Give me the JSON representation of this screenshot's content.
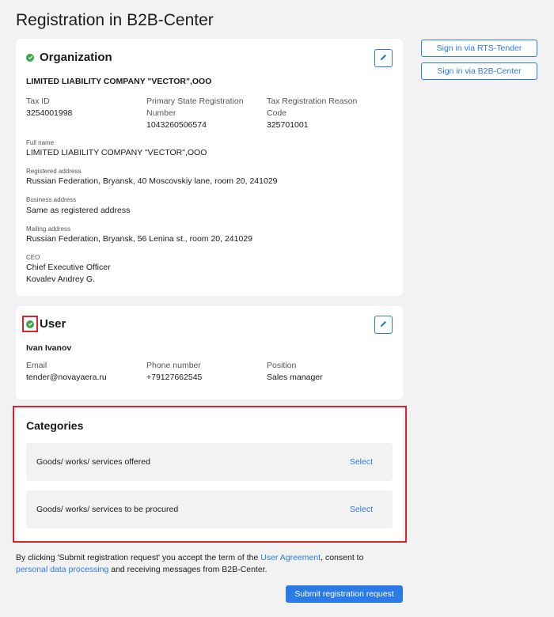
{
  "page": {
    "title": "Registration in B2B-Center"
  },
  "side_buttons": {
    "rts": "Sign in via RTS-Tender",
    "b2b": "Sign in via B2B-Center"
  },
  "organization": {
    "heading": "Organization",
    "name": "LIMITED LIABILITY COMPANY \"VECTOR\",OOO",
    "tax_id_label": "Tax ID",
    "tax_id": "3254001998",
    "psrn_label_1": "Primary State Registration",
    "psrn_label_2": "Number",
    "psrn": "1043260506574",
    "trrc_label_1": "Tax Registration Reason",
    "trrc_label_2": "Code",
    "trrc": "325701001",
    "full_name_label": "Full name",
    "full_name": "LIMITED LIABILITY COMPANY \"VECTOR\",OOO",
    "registered_address_label": "Registered address",
    "registered_address": "Russian Federation, Bryansk, 40 Moscovskiy lane, room 20, 241029",
    "business_address_label": "Business address",
    "business_address": "Same as registered address",
    "mailing_address_label": "Mailing address",
    "mailing_address": "Russian Federation, Bryansk, 56 Lenina st., room 20, 241029",
    "ceo_label": "CEO",
    "ceo_title": "Chief Executive Officer",
    "ceo_name": "Kovalev Andrey G."
  },
  "user": {
    "heading": "User",
    "name": "Ivan Ivanov",
    "email_label": "Email",
    "email": "tender@novayaera.ru",
    "phone_label": "Phone number",
    "phone": "+79127662545",
    "position_label": "Position",
    "position": "Sales manager"
  },
  "categories": {
    "heading": "Categories",
    "rows": [
      {
        "label": "Goods/ works/ services offered",
        "action": "Select"
      },
      {
        "label": "Goods/ works/ services to be procured",
        "action": "Select"
      }
    ]
  },
  "consent": {
    "part1": "By clicking 'Submit registration request' you accept the term of the ",
    "agreement_link": "User Agreement",
    "part2": ", consent to ",
    "processing_link": "personal data processing",
    "part3": " and receiving messages from B2B-Center."
  },
  "submit_label": "Submit registration request",
  "colors": {
    "accent": "#2b7be6",
    "success": "#3aa84a",
    "highlight": "#d9232e"
  }
}
